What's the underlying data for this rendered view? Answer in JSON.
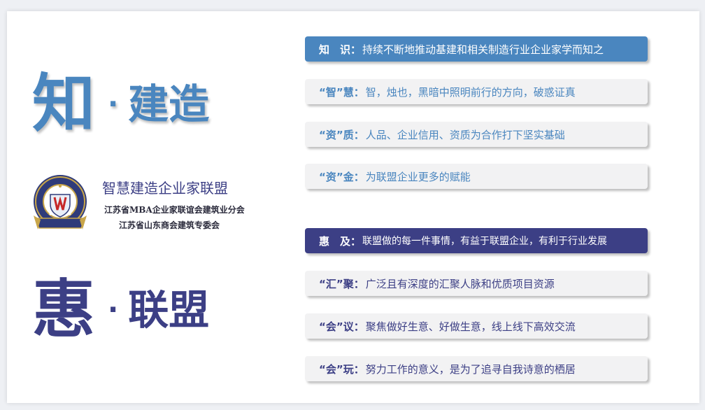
{
  "left": {
    "top_headline": {
      "big": "知",
      "dot": "·",
      "rest": "建造"
    },
    "bottom_headline": {
      "big": "惠",
      "dot": "·",
      "rest": "联盟"
    },
    "org": {
      "title": "智慧建造企业家联盟",
      "sub1": "江苏省MBA企业家联谊会建筑业分会",
      "sub2": "江苏省山东商会建筑专委会"
    },
    "logo": {
      "top_chars": "知 · 建 造   惠 · 联 盟",
      "bottom_text": "智慧建造企业家联盟"
    }
  },
  "knowledge": {
    "header": {
      "key": "知　识：",
      "value": "持续不断地推动基建和相关制造行业企业家学而知之"
    },
    "items": [
      {
        "key": "“智”慧：",
        "value": "智，烛也，黑暗中照明前行的方向，破惑证真"
      },
      {
        "key": "“资”质：",
        "value": "人品、企业信用、资质为合作打下坚实基础"
      },
      {
        "key": "“资”金：",
        "value": "为联盟企业更多的赋能"
      }
    ]
  },
  "benefit": {
    "header": {
      "key": "惠　及：",
      "value": "联盟做的每一件事情，有益于联盟企业，有利于行业发展"
    },
    "items": [
      {
        "key": "“汇”聚：",
        "value": "广泛且有深度的汇聚人脉和优质项目资源"
      },
      {
        "key": "“会”议：",
        "value": "聚焦做好生意、好做生意，线上线下高效交流"
      },
      {
        "key": "“会”玩：",
        "value": "努力工作的意义，是为了追寻自我诗意的栖居"
      }
    ]
  },
  "colors": {
    "blue": "#4a86bf",
    "navy": "#3c3f85",
    "bar_bg": "#f2f2f3"
  }
}
